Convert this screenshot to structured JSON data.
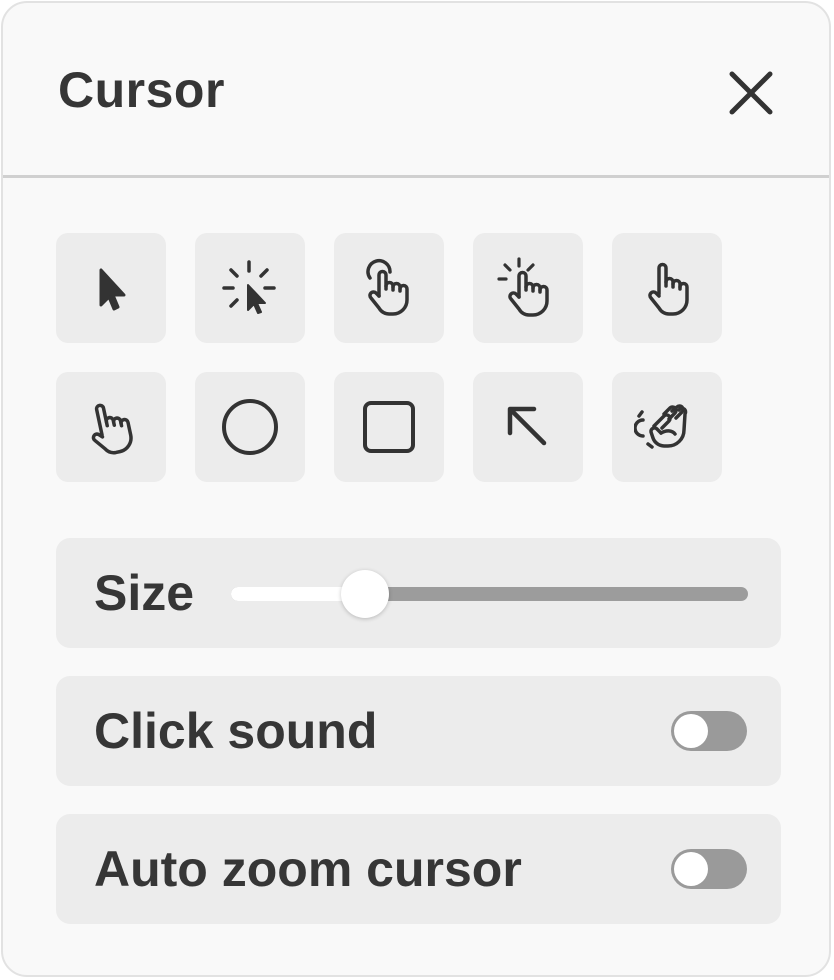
{
  "panel": {
    "title": "Cursor"
  },
  "cursor_styles": [
    {
      "icon": "arrow-pointer-icon",
      "selected": false
    },
    {
      "icon": "pointer-click-burst-icon",
      "selected": false
    },
    {
      "icon": "hand-tap-icon",
      "selected": false
    },
    {
      "icon": "hand-click-burst-icon",
      "selected": false
    },
    {
      "icon": "hand-pointer-icon",
      "selected": false
    },
    {
      "icon": "hand-pointer-tilted-icon",
      "selected": false
    },
    {
      "icon": "circle-icon",
      "selected": false
    },
    {
      "icon": "square-icon",
      "selected": false
    },
    {
      "icon": "arrow-up-left-icon",
      "selected": false
    },
    {
      "icon": "hand-grab-icon",
      "selected": false
    }
  ],
  "size": {
    "label": "Size",
    "value": 0.26
  },
  "click_sound": {
    "label": "Click sound",
    "enabled": false
  },
  "auto_zoom": {
    "label": "Auto zoom cursor",
    "enabled": false
  },
  "colors": {
    "panel_background": "#f9f9f9",
    "card_background": "#ececec",
    "text": "#363636",
    "track": "#9c9c9c",
    "toggle_off": "#9a9a9a"
  }
}
